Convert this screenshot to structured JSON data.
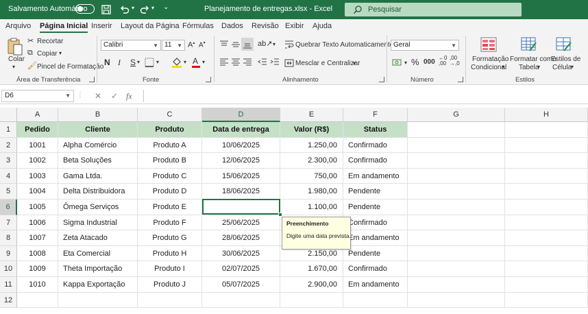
{
  "titlebar": {
    "autosave_label": "Salvamento Automático",
    "doc_title": "Planejamento de entregas.xlsx  -  Excel",
    "search_placeholder": "Pesquisar",
    "accent": "#217346"
  },
  "menu": {
    "tabs": [
      "Arquivo",
      "Página Inicial",
      "Inserir",
      "Layout da Página",
      "Fórmulas",
      "Dados",
      "Revisão",
      "Exibir",
      "Ajuda"
    ],
    "active": "Página Inicial"
  },
  "ribbon": {
    "clipboard": {
      "paste": "Colar",
      "cut": "Recortar",
      "copy": "Copiar",
      "format_painter": "Pincel de Formatação",
      "group": "Área de Transferência"
    },
    "font": {
      "name": "Calibri",
      "size": "11",
      "bold": "N",
      "italic": "I",
      "underline": "S",
      "group": "Fonte"
    },
    "alignment": {
      "wrap": "Quebrar Texto Automaticamente",
      "merge": "Mesclar e Centralizar",
      "group": "Alinhamento"
    },
    "number": {
      "format": "Geral",
      "group": "Número"
    },
    "styles": {
      "conditional": "Formatação\nCondicional",
      "conditional_1": "Formatação",
      "conditional_2": "Condicional",
      "table_1": "Formatar como",
      "table_2": "Tabela",
      "cell_1": "Estilos de",
      "cell_2": "Célula",
      "group": "Estilos"
    }
  },
  "formula_bar": {
    "name_box": "D6",
    "value": ""
  },
  "columns": [
    {
      "letter": "A",
      "width": 60
    },
    {
      "letter": "B",
      "width": 116
    },
    {
      "letter": "C",
      "width": 94
    },
    {
      "letter": "D",
      "width": 114
    },
    {
      "letter": "E",
      "width": 92
    },
    {
      "letter": "F",
      "width": 94
    },
    {
      "letter": "G",
      "width": 142
    },
    {
      "letter": "H",
      "width": 107
    }
  ],
  "selected": {
    "column": "D",
    "row": 6
  },
  "table": {
    "headers": [
      "Pedido",
      "Cliente",
      "Produto",
      "Data de entrega",
      "Valor (R$)",
      "Status"
    ],
    "rows": [
      [
        "1001",
        "Alpha Comércio",
        "Produto A",
        "10/06/2025",
        "1.250,00",
        "Confirmado"
      ],
      [
        "1002",
        "Beta Soluções",
        "Produto B",
        "12/06/2025",
        "2.300,00",
        "Confirmado"
      ],
      [
        "1003",
        "Gama Ltda.",
        "Produto C",
        "15/06/2025",
        "750,00",
        "Em andamento"
      ],
      [
        "1004",
        "Delta Distribuidora",
        "Produto D",
        "18/06/2025",
        "1.980,00",
        "Pendente"
      ],
      [
        "1005",
        "Ômega Serviços",
        "Produto E",
        "",
        "1.100,00",
        "Pendente"
      ],
      [
        "1006",
        "Sigma Industrial",
        "Produto F",
        "25/06/2025",
        "",
        "Confirmado"
      ],
      [
        "1007",
        "Zeta Atacado",
        "Produto G",
        "28/06/2025",
        "",
        "Em andamento"
      ],
      [
        "1008",
        "Eta Comercial",
        "Produto H",
        "30/06/2025",
        "2.150,00",
        "Pendente"
      ],
      [
        "1009",
        "Theta Importação",
        "Produto I",
        "02/07/2025",
        "1.670,00",
        "Confirmado"
      ],
      [
        "1010",
        "Kappa Exportação",
        "Produto J",
        "05/07/2025",
        "2.900,00",
        "Em andamento"
      ]
    ],
    "header_fill": "#c6e0c8"
  },
  "row_numbers": [
    "1",
    "2",
    "3",
    "4",
    "5",
    "6",
    "7",
    "8",
    "9",
    "10",
    "11",
    "12"
  ],
  "tooltip": {
    "title": "Preenchimento",
    "body": "Digite uma data prevista."
  }
}
